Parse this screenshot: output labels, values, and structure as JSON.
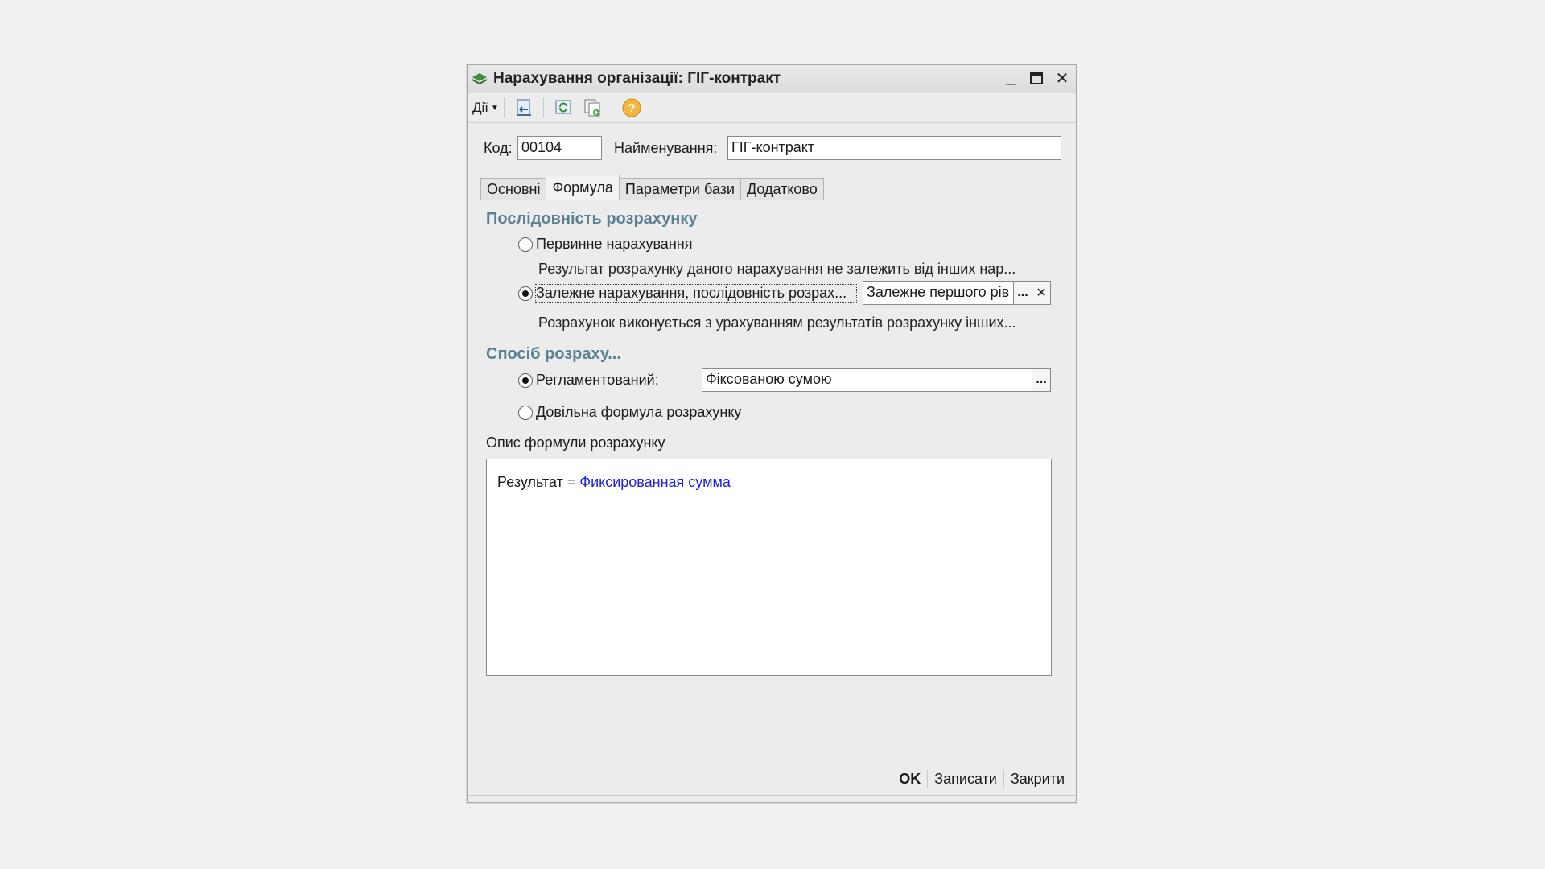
{
  "window": {
    "title": "Нарахування організації: ГІГ-контракт"
  },
  "toolbar": {
    "actions_label": "Дії",
    "icons": [
      "save-close-icon",
      "refresh-icon",
      "copy-icon",
      "help-icon"
    ]
  },
  "header": {
    "code_label": "Код:",
    "code_value": "00104",
    "name_label": "Найменування:",
    "name_value": "ГІГ-контракт"
  },
  "tabs": [
    {
      "label": "Основні",
      "active": false
    },
    {
      "label": "Формула",
      "active": true
    },
    {
      "label": "Параметри бази",
      "active": false
    },
    {
      "label": "Додатково",
      "active": false
    }
  ],
  "sequence": {
    "title": "Послідовність розрахунку",
    "primary_label": "Первинне нарахування",
    "primary_hint": "Результат розрахунку даного нарахування не залежить від інших нар...",
    "dependent_label": "Залежне нарахування, послідовність розрах...",
    "dependent_value": "Залежне першого рів",
    "dependent_hint": "Розрахунок виконується з урахуванням результатів розрахунку інших..."
  },
  "method": {
    "title": "Спосіб розраху...",
    "regulated_label": "Регламентований:",
    "regulated_value": "Фіксованою сумою",
    "custom_label": "Довільна формула розрахунку"
  },
  "description": {
    "label": "Опис формули розрахунку",
    "result_prefix": "Результат =",
    "result_link": "Фиксированная сумма"
  },
  "footer": {
    "ok": "OK",
    "save": "Записати",
    "close": "Закрити"
  },
  "colors": {
    "section_title": "#5b7f93",
    "link": "#2020dd"
  }
}
